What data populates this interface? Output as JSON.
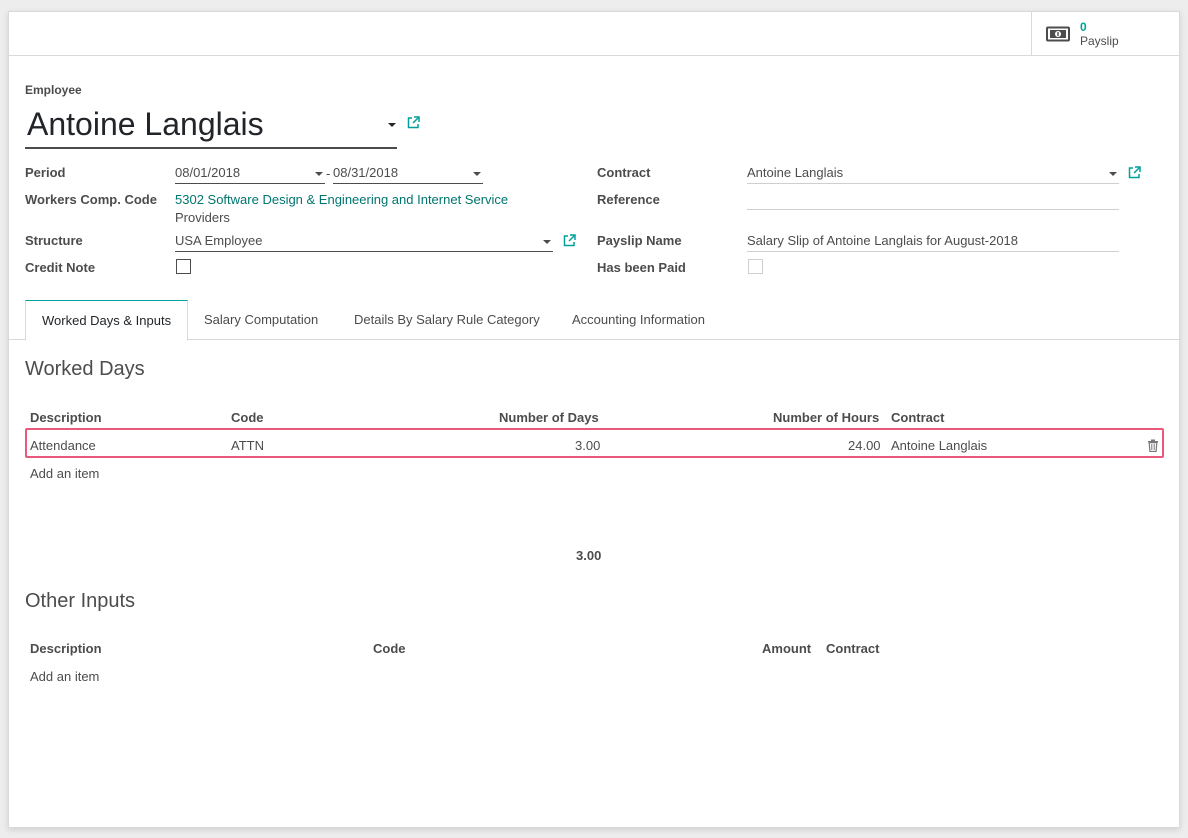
{
  "stat_button": {
    "value": "0",
    "label": "Payslip"
  },
  "employee": {
    "label": "Employee",
    "name": "Antoine Langlais"
  },
  "fields": {
    "period": {
      "label": "Period",
      "start": "08/01/2018",
      "separator": "-",
      "end": "08/31/2018"
    },
    "workers_comp": {
      "label": "Workers Comp. Code",
      "value_line1": "5302 Software Design & Engineering and Internet Service",
      "value_line2": "Providers"
    },
    "structure": {
      "label": "Structure",
      "value": "USA Employee"
    },
    "credit_note": {
      "label": "Credit Note",
      "checked": false
    },
    "contract": {
      "label": "Contract",
      "value": "Antoine Langlais"
    },
    "reference": {
      "label": "Reference",
      "value": ""
    },
    "payslip_name": {
      "label": "Payslip Name",
      "value": "Salary Slip of Antoine Langlais for August-2018"
    },
    "has_been_paid": {
      "label": "Has been Paid",
      "checked": false
    }
  },
  "tabs": [
    {
      "label": "Worked Days & Inputs",
      "active": true
    },
    {
      "label": "Salary Computation"
    },
    {
      "label": "Details By Salary Rule Category"
    },
    {
      "label": "Accounting Information"
    }
  ],
  "worked_days": {
    "title": "Worked Days",
    "columns": {
      "description": "Description",
      "code": "Code",
      "days": "Number of Days",
      "hours": "Number of Hours",
      "contract": "Contract"
    },
    "rows": [
      {
        "description": "Attendance",
        "code": "ATTN",
        "days": "3.00",
        "hours": "24.00",
        "contract": "Antoine Langlais"
      }
    ],
    "add_item": "Add an item",
    "total_days": "3.00"
  },
  "other_inputs": {
    "title": "Other Inputs",
    "columns": {
      "description": "Description",
      "code": "Code",
      "amount": "Amount",
      "contract": "Contract"
    },
    "add_item": "Add an item"
  },
  "colors": {
    "accent": "#00a09d",
    "link": "#00756f",
    "highlight": "#e8597c"
  },
  "icons": {
    "stat": "money-icon",
    "external": "external-link-icon",
    "delete": "trash-icon"
  }
}
